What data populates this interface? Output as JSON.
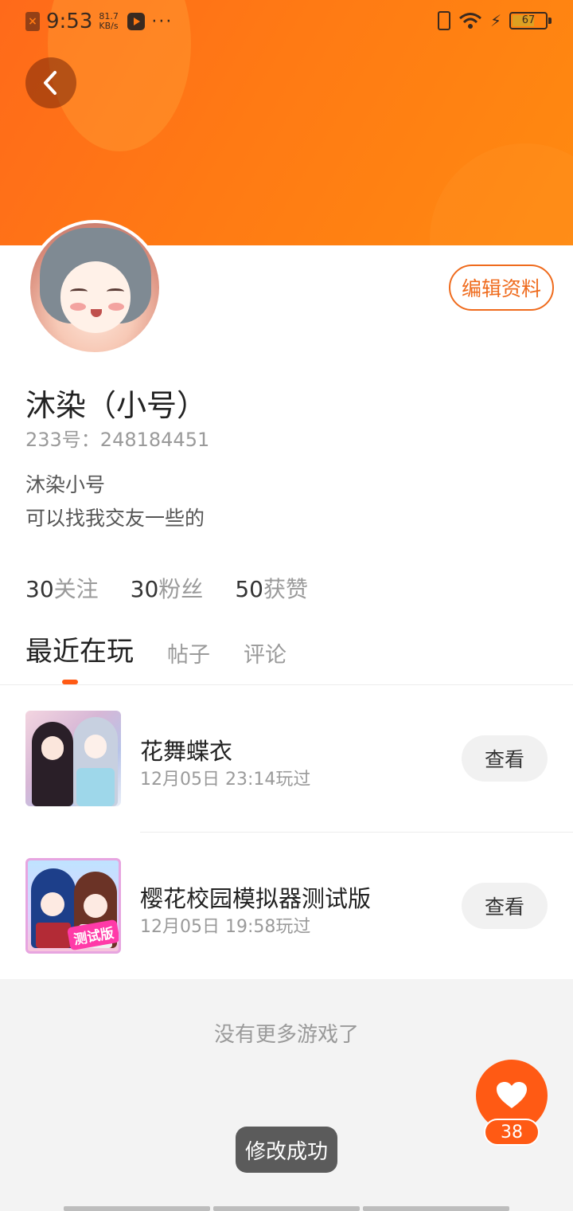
{
  "status_bar": {
    "time": "9:53",
    "speed_value": "81.7",
    "speed_unit": "KB/s",
    "more": "···",
    "battery": "67"
  },
  "profile": {
    "edit_label": "编辑资料",
    "nickname": "沐染（小号）",
    "uid": "233号：248184451",
    "bio_line1": "沐染小号",
    "bio_line2": "可以找我交友一些的"
  },
  "stats": [
    {
      "num": "30",
      "label": "关注"
    },
    {
      "num": "30",
      "label": "粉丝"
    },
    {
      "num": "50",
      "label": "获赞"
    }
  ],
  "tabs": [
    {
      "label": "最近在玩",
      "active": true
    },
    {
      "label": "帖子",
      "active": false
    },
    {
      "label": "评论",
      "active": false
    }
  ],
  "games": [
    {
      "title": "花舞蝶衣",
      "time": "12月05日 23:14玩过",
      "button": "查看"
    },
    {
      "title": "樱花校园模拟器测试版",
      "time": "12月05日 19:58玩过",
      "button": "查看",
      "badge": "测试版"
    }
  ],
  "no_more": "没有更多游戏了",
  "fab": {
    "count": "38"
  },
  "toast": "修改成功",
  "colors": {
    "accent": "#ff5a14",
    "banner_start": "#ff6a1a",
    "banner_end": "#ff8a10"
  }
}
